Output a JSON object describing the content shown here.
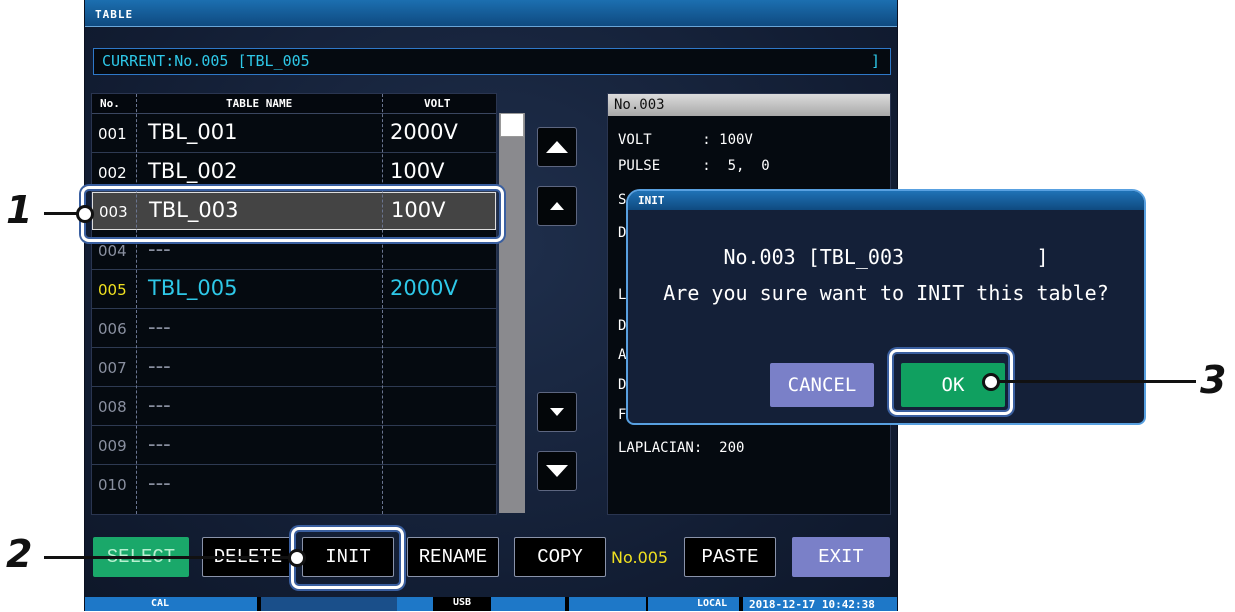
{
  "window_title": "TABLE",
  "current": {
    "text": "CURRENT:No.005 [TBL_005",
    "end": "]"
  },
  "table": {
    "headers": {
      "no": "No.",
      "name": "TABLE NAME",
      "volt": "VOLT"
    },
    "rows": [
      {
        "no": "001",
        "name": "TBL_001",
        "volt": "2000V"
      },
      {
        "no": "002",
        "name": "TBL_002",
        "volt": "100V"
      },
      {
        "no": "003",
        "name": "TBL_003",
        "volt": "100V"
      },
      {
        "no": "004",
        "name": "---",
        "volt": ""
      },
      {
        "no": "005",
        "name": "TBL_005",
        "volt": "2000V"
      },
      {
        "no": "006",
        "name": "---",
        "volt": ""
      },
      {
        "no": "007",
        "name": "---",
        "volt": ""
      },
      {
        "no": "008",
        "name": "---",
        "volt": ""
      },
      {
        "no": "009",
        "name": "---",
        "volt": ""
      },
      {
        "no": "010",
        "name": "---",
        "volt": ""
      }
    ]
  },
  "detail": {
    "header": "No.003",
    "volt": "VOLT      : 100V",
    "pulse": "PULSE     :  5,  0",
    "partial": [
      "S",
      "D",
      "L",
      "D",
      "A",
      "D",
      "F"
    ],
    "laplacian": "LAPLACIAN:  200"
  },
  "dialog": {
    "title": "INIT",
    "line1": "No.003 [TBL_003           ]",
    "line2": "Are you sure want to INIT this table?",
    "cancel": "CANCEL",
    "ok": "OK"
  },
  "buttons": {
    "select": "SELECT",
    "delete": "DELETE",
    "init": "INIT",
    "rename": "RENAME",
    "copy": "COPY",
    "copy_no": "No.005",
    "paste": "PASTE",
    "exit": "EXIT"
  },
  "statusbar": {
    "cal": "CAL",
    "usb": "USB",
    "local": "LOCAL",
    "datetime": "2018-12-17 10:42:38"
  },
  "callouts": {
    "c1": "1",
    "c2": "2",
    "c3": "3"
  },
  "colors": {
    "accent_cyan": "#2ec8e8",
    "current_no_yellow": "#f0e020",
    "select_green": "#1aa86a",
    "ok_green": "#10a060",
    "cancel_purple": "#7a80c8",
    "exit_purple": "#7a80c8",
    "highlight_row": "#444444"
  }
}
